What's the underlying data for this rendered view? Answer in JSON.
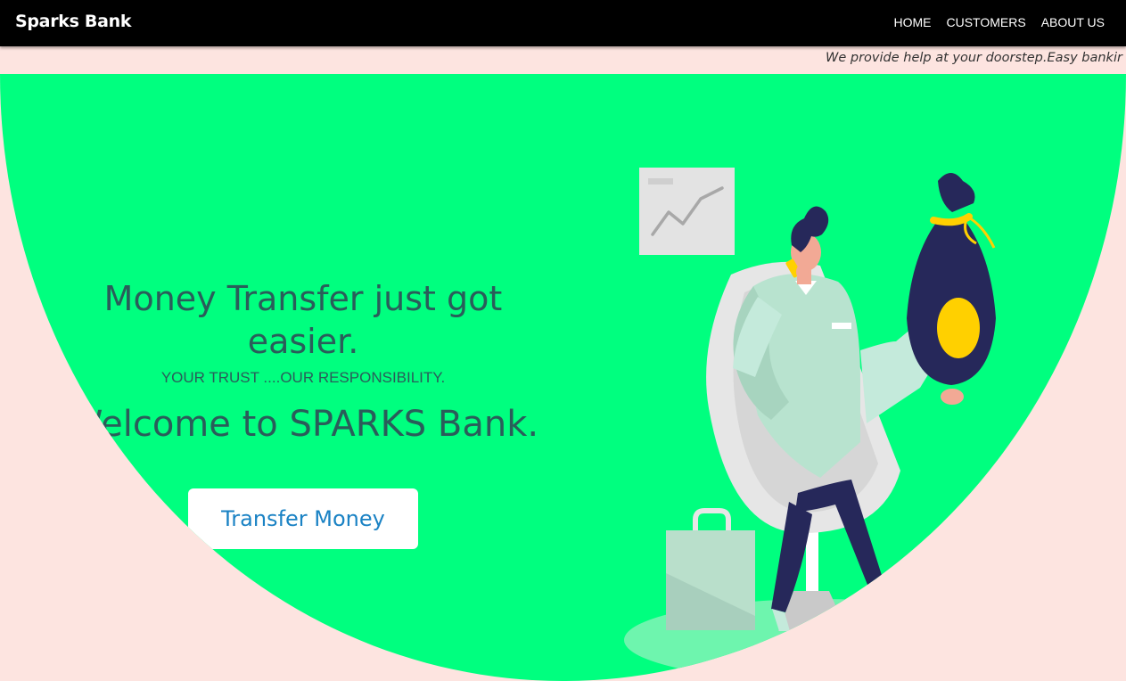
{
  "navbar": {
    "brand": "Sparks Bank",
    "links": [
      "HOME",
      "CUSTOMERS",
      "ABOUT US"
    ]
  },
  "marquee": {
    "text": "We provide help at your doorstep.Easy bankir"
  },
  "hero": {
    "headline": "Money Transfer just got easier.",
    "tagline": "YOUR TRUST ....OUR RESPONSIBILITY.",
    "welcome": "Welcome to SPARKS Bank.",
    "button_label": "Transfer Money"
  },
  "illustration": {
    "icon": "banker-with-money-bag-illustration"
  },
  "colors": {
    "hero_bg": "#00ff7f",
    "page_bg": "#fde4e0",
    "navbar_bg": "#000000",
    "heading_text": "#2a5d5a",
    "button_text": "#1a82c4"
  }
}
